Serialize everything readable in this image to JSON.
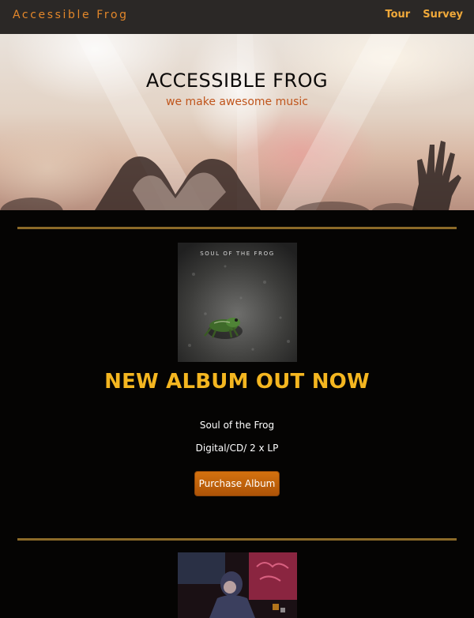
{
  "nav": {
    "brand": "Accessible Frog",
    "links": [
      {
        "label": "Tour"
      },
      {
        "label": "Survey"
      }
    ]
  },
  "hero": {
    "title": "ACCESSIBLE FROG",
    "subtitle": "we make awesome music"
  },
  "album": {
    "cover_text": "SOUL OF THE FROG",
    "headline": "NEW ALBUM OUT NOW",
    "name": "Soul of the Frog",
    "formats": "Digital/CD/ 2 x LP",
    "button_label": "Purchase Album"
  },
  "colors": {
    "accent_orange": "#e3872a",
    "headline_yellow": "#f4b620",
    "divider_gold": "#8c6a28",
    "background": "#050403"
  }
}
